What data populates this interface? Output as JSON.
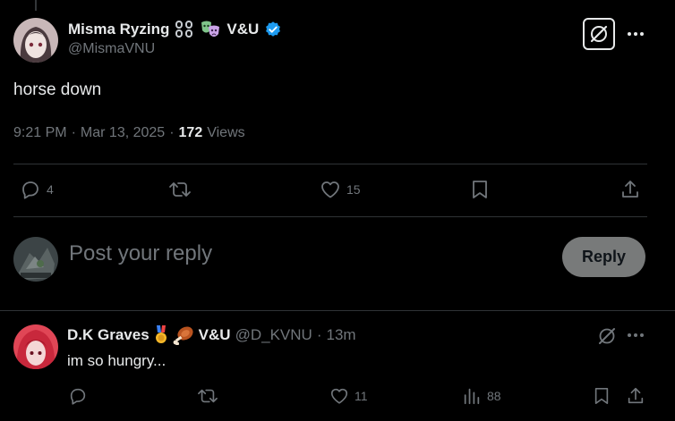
{
  "post": {
    "author": {
      "display_name": "Misma Ryzing",
      "suffix": "V&U",
      "handle": "@MismaVNU"
    },
    "text": "horse down",
    "time": "9:21 PM",
    "separator": "·",
    "date": "Mar 13, 2025",
    "views_count": "172",
    "views_label": "Views",
    "actions": {
      "replies": "4",
      "reposts": "",
      "likes": "15"
    }
  },
  "composer": {
    "placeholder": "Post your reply",
    "button_label": "Reply"
  },
  "reply": {
    "display_name": "D.K Graves",
    "suffix": "V&U",
    "handle": "@D_KVNU",
    "separator": "·",
    "time": "13m",
    "text": "im so hungry...",
    "actions": {
      "replies": "",
      "reposts": "",
      "likes": "11",
      "views": "88"
    }
  },
  "colors": {
    "background": "#000000",
    "text": "#e7e9ea",
    "muted": "#71767b",
    "verified": "#1d9bf0",
    "reply_button_bg": "#787a7a"
  }
}
